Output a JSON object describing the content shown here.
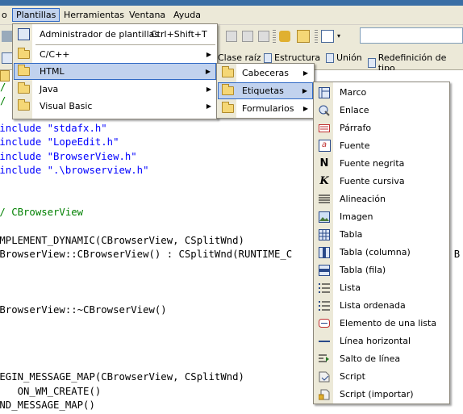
{
  "menubar": {
    "items": [
      {
        "label": "o"
      },
      {
        "label": "Plantillas"
      },
      {
        "label": "Herramientas"
      },
      {
        "label": "Ventana"
      },
      {
        "label": "Ayuda"
      }
    ]
  },
  "toolbar2": {
    "items": [
      "Clase raíz",
      "Estructura",
      "Unión",
      "Redefinición de tipo"
    ]
  },
  "code": [
    {
      "text": "/",
      "color": "green"
    },
    {
      "text": "/",
      "color": "green"
    },
    {
      "text": "#include \"stdafx.h\"",
      "color": "blue"
    },
    {
      "text": "#include \"LopeEdit.h\"",
      "color": "blue"
    },
    {
      "text": "#include \"BrowserView.h\"",
      "color": "blue"
    },
    {
      "text": "#include \".\\browserview.h\"",
      "color": "blue"
    },
    {
      "text": "// CBrowserView",
      "color": "green"
    },
    {
      "text": "IMPLEMENT_DYNAMIC(CBrowserView, CSplitWnd)",
      "color": "black"
    },
    {
      "text": "CBrowserView::CBrowserView() : CSplitWnd(RUNTIME_C",
      "color": "black"
    },
    {
      "text": "CBrowserView::~CBrowserView()",
      "color": "black"
    },
    {
      "text": "BEGIN_MESSAGE_MAP(CBrowserView, CSplitWnd)",
      "color": "black"
    },
    {
      "text": "    ON_WM_CREATE()",
      "color": "black"
    },
    {
      "text": "END_MESSAGE_MAP()",
      "color": "black"
    },
    {
      "text": ", B",
      "color": "black"
    }
  ],
  "plantillas_menu": {
    "items": [
      {
        "label": "Administrador de plantillas",
        "shortcut": "Ctrl+Shift+T",
        "icon": "template-manager-icon"
      },
      {
        "label": "C/C++",
        "submenu": true,
        "icon": "folder-icon"
      },
      {
        "label": "HTML",
        "submenu": true,
        "icon": "folder-icon"
      },
      {
        "label": "Java",
        "submenu": true,
        "icon": "folder-icon"
      },
      {
        "label": "Visual Basic",
        "submenu": true,
        "icon": "folder-icon"
      }
    ]
  },
  "html_menu": {
    "items": [
      {
        "label": "Cabeceras",
        "icon": "folder-icon"
      },
      {
        "label": "Etiquetas",
        "icon": "folder-icon"
      },
      {
        "label": "Formularios",
        "icon": "folder-icon"
      }
    ]
  },
  "etiquetas_menu": {
    "items": [
      {
        "label": "Marco",
        "icon": "frame-icon"
      },
      {
        "label": "Enlace",
        "icon": "link-icon"
      },
      {
        "label": "Párrafo",
        "icon": "paragraph-icon"
      },
      {
        "label": "Fuente",
        "icon": "font-icon"
      },
      {
        "label": "Fuente negrita",
        "icon": "bold-icon"
      },
      {
        "label": "Fuente cursiva",
        "icon": "italic-icon"
      },
      {
        "label": "Alineación",
        "icon": "align-icon"
      },
      {
        "label": "Imagen",
        "icon": "image-icon"
      },
      {
        "label": "Tabla",
        "icon": "table-icon"
      },
      {
        "label": "Tabla (columna)",
        "icon": "table-column-icon"
      },
      {
        "label": "Tabla (fila)",
        "icon": "table-row-icon"
      },
      {
        "label": "Lista",
        "icon": "list-icon"
      },
      {
        "label": "Lista ordenada",
        "icon": "ordered-list-icon"
      },
      {
        "label": "Elemento de una lista",
        "icon": "list-item-icon"
      },
      {
        "label": "Línea horizontal",
        "icon": "horizontal-rule-icon"
      },
      {
        "label": "Salto de línea",
        "icon": "line-break-icon"
      },
      {
        "label": "Script",
        "icon": "script-icon"
      },
      {
        "label": "Script (importar)",
        "icon": "script-import-icon"
      }
    ]
  }
}
